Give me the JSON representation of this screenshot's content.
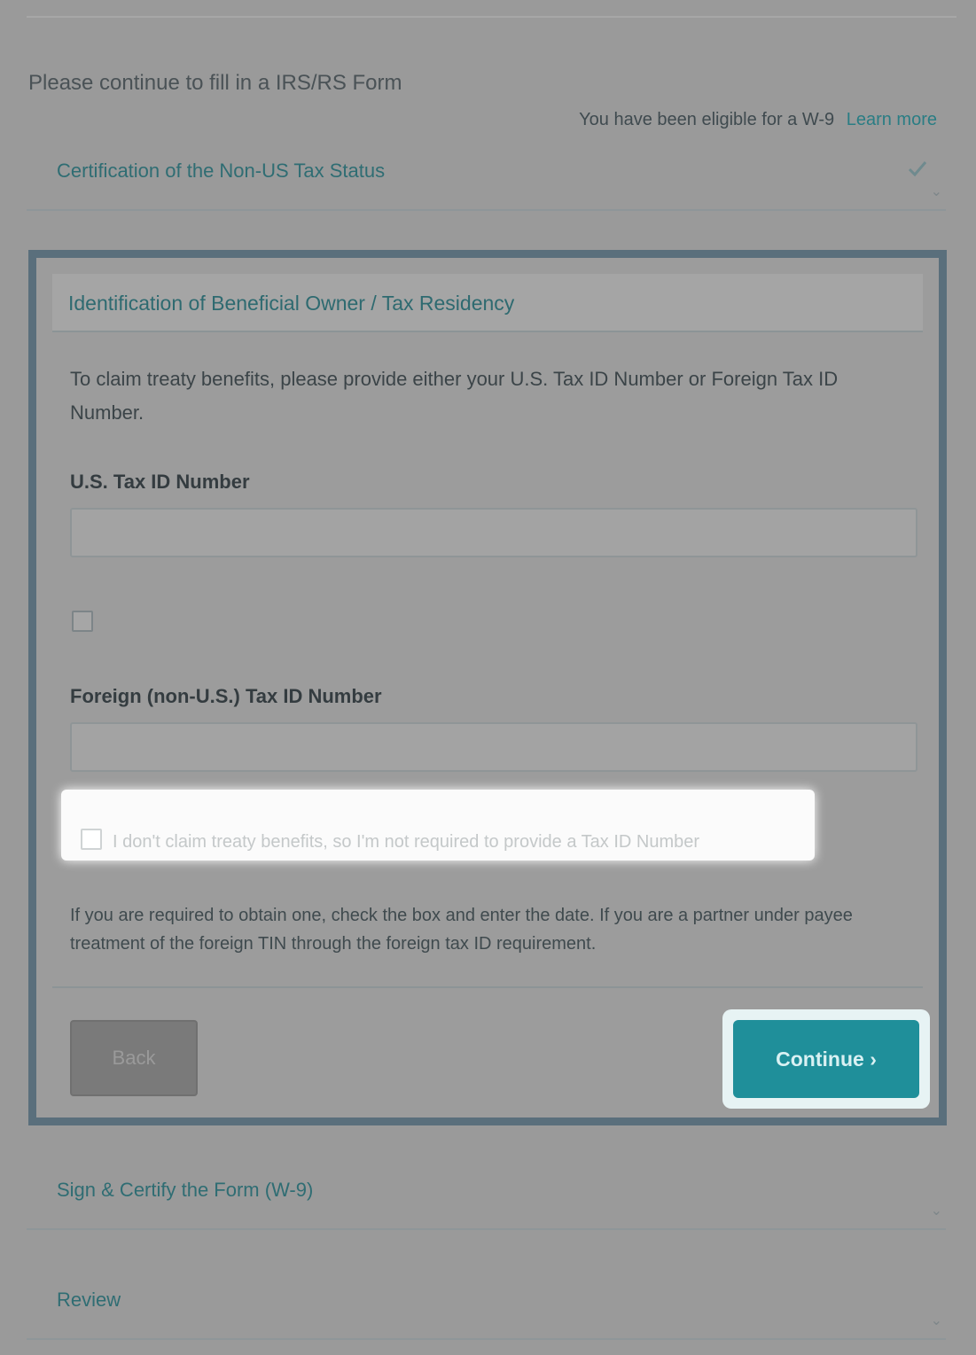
{
  "page": {
    "title": "Please continue to fill in a IRS/RS Form",
    "step_text": "You have been eligible for a W-9",
    "step_link": "Learn more"
  },
  "steps": {
    "completed_label": "Certification of the Non-US Tax Status",
    "upcoming_label": "Sign & Certify the Form (W-9)",
    "final_label": "Review"
  },
  "panel": {
    "title": "Identification of Beneficial Owner / Tax Residency",
    "intro": "To claim treaty benefits, please provide either your U.S. Tax ID Number or Foreign Tax ID Number.",
    "us_tin_label": "U.S. Tax ID Number",
    "us_tin_value": "",
    "foreign_tin_label": "Foreign (non-U.S.) Tax ID Number",
    "foreign_tin_value": "",
    "ftin_not_required_text": "I don't claim treaty benefits, so I'm not required to provide a Tax ID Number",
    "note": "If you are required to obtain one, check the box and enter the date. If you are a partner under payee treatment of the foreign TIN through the foreign tax ID requirement.",
    "back_label": "Back",
    "continue_label": "Continue"
  },
  "icons": {
    "completed_step": "check-icon",
    "collapsed_step": "chevron-down-icon"
  },
  "colors": {
    "accent": "#1f8f9a",
    "panel_border": "#5a6f7c",
    "link": "#2a7d84"
  }
}
